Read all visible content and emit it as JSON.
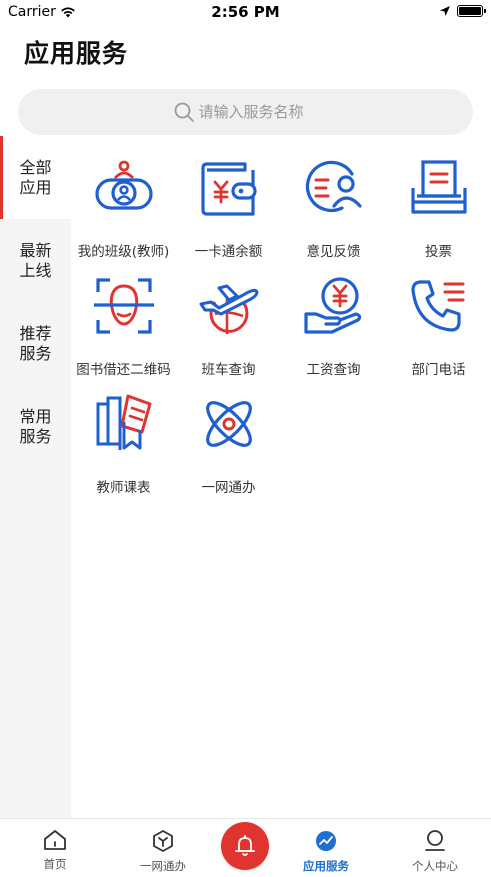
{
  "status": {
    "carrier": "Carrier",
    "time": "2:56 PM"
  },
  "header": {
    "title": "应用服务"
  },
  "search": {
    "placeholder": "请输入服务名称"
  },
  "sidebar": {
    "items": [
      {
        "label": "全部应用",
        "active": true
      },
      {
        "label": "最新上线",
        "active": false
      },
      {
        "label": "推荐服务",
        "active": false
      },
      {
        "label": "常用服务",
        "active": false
      }
    ]
  },
  "services": [
    {
      "label": "我的班级(教师)",
      "icon": "class-icon"
    },
    {
      "label": "一卡通余额",
      "icon": "wallet-icon"
    },
    {
      "label": "意见反馈",
      "icon": "feedback-icon"
    },
    {
      "label": "投票",
      "icon": "vote-icon"
    },
    {
      "label": "图书借还二维码",
      "icon": "face-scan-icon"
    },
    {
      "label": "班车查询",
      "icon": "airplane-icon"
    },
    {
      "label": "工资查询",
      "icon": "salary-icon"
    },
    {
      "label": "部门电话",
      "icon": "phone-icon"
    },
    {
      "label": "教师课表",
      "icon": "books-icon"
    },
    {
      "label": "一网通办",
      "icon": "atom-icon"
    }
  ],
  "tabbar": {
    "items": [
      {
        "label": "首页",
        "icon": "home-icon"
      },
      {
        "label": "一网通办",
        "icon": "cube-icon"
      },
      {
        "label": "",
        "icon": "bell-icon"
      },
      {
        "label": "应用服务",
        "icon": "chart-icon",
        "active": true
      },
      {
        "label": "个人中心",
        "icon": "user-icon"
      }
    ]
  },
  "colors": {
    "accent_red": "#e0342e",
    "icon_blue": "#1f5fd0",
    "active_tab": "#1f6fd1"
  }
}
